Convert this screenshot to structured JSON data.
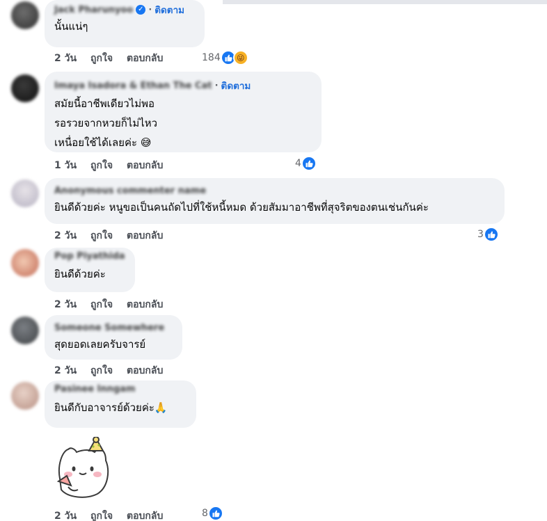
{
  "comments": [
    {
      "name": "Jack Pharunyoo",
      "verified": true,
      "follow": "ติดตาม",
      "lines": [
        "นั้นแน่ๆ"
      ],
      "time": "2 วัน",
      "like": "ถูกใจ",
      "reply": "ตอบกลับ",
      "reactions": "184"
    },
    {
      "name": "Imaya Isadora & Ethan The Cat",
      "verified": false,
      "follow": "ติดตาม",
      "lines": [
        "สมัยนี้อาชีพเดียวไม่พอ",
        "รอรวยจากหวยก็ไม่ไหว",
        "เหนื่อยใช้ได้เลยค่ะ 😅"
      ],
      "time": "1 วัน",
      "like": "ถูกใจ",
      "reply": "ตอบกลับ",
      "reactions": "4"
    },
    {
      "name": "Anonymous commenter name",
      "verified": false,
      "follow": "",
      "lines": [
        "ยินดีด้วยค่ะ หนูขอเป็นคนถัดไปที่ใช้หนี้หมด ด้วยสัมมาอาชีพที่สุจริตของตนเช่นกันค่ะ"
      ],
      "time": "2 วัน",
      "like": "ถูกใจ",
      "reply": "ตอบกลับ",
      "reactions": "3"
    },
    {
      "name": "Pop Piyathida",
      "verified": false,
      "follow": "",
      "lines": [
        "ยินดีด้วยค่ะ"
      ],
      "time": "2 วัน",
      "like": "ถูกใจ",
      "reply": "ตอบกลับ",
      "reactions": ""
    },
    {
      "name": "Someone Somewhere",
      "verified": false,
      "follow": "",
      "lines": [
        "สุดยอดเลยครับจารย์"
      ],
      "time": "2 วัน",
      "like": "ถูกใจ",
      "reply": "ตอบกลับ",
      "reactions": ""
    },
    {
      "name": "Pasinee Inngam",
      "verified": false,
      "follow": "",
      "lines": [
        "ยินดีกับอาจารย์ด้วยค่ะ🙏"
      ],
      "time": "2 วัน",
      "like": "ถูกใจ",
      "reply": "ตอบกลับ",
      "reactions": "8"
    }
  ],
  "colors": {
    "bubble": "#f0f2f5",
    "accent": "#1877f2",
    "follow": "#216fdb"
  },
  "sticker": "cat-sticker"
}
